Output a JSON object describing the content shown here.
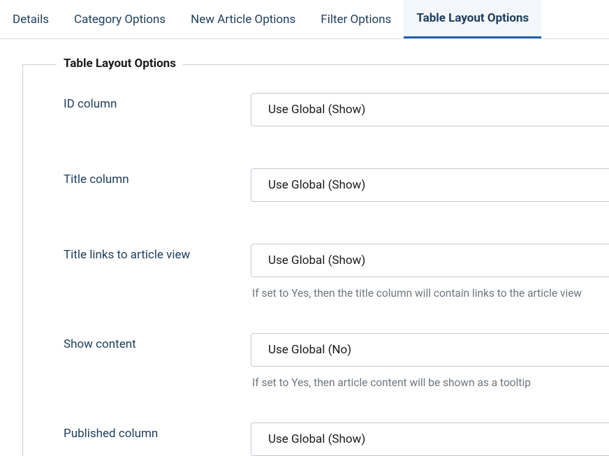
{
  "tabs": {
    "details": "Details",
    "category_options": "Category Options",
    "new_article_options": "New Article Options",
    "filter_options": "Filter Options",
    "table_layout_options": "Table Layout Options"
  },
  "fieldset": {
    "legend": "Table Layout Options"
  },
  "fields": {
    "id_column": {
      "label": "ID column",
      "value": "Use Global (Show)"
    },
    "title_column": {
      "label": "Title column",
      "value": "Use Global (Show)"
    },
    "title_links": {
      "label": "Title links to article view",
      "value": "Use Global (Show)",
      "help": "If set to Yes, then the title column will contain links to the article view"
    },
    "show_content": {
      "label": "Show content",
      "value": "Use Global (No)",
      "help": "If set to Yes, then article content will be shown as a tooltip"
    },
    "published_column": {
      "label": "Published column",
      "value": "Use Global (Show)"
    }
  }
}
